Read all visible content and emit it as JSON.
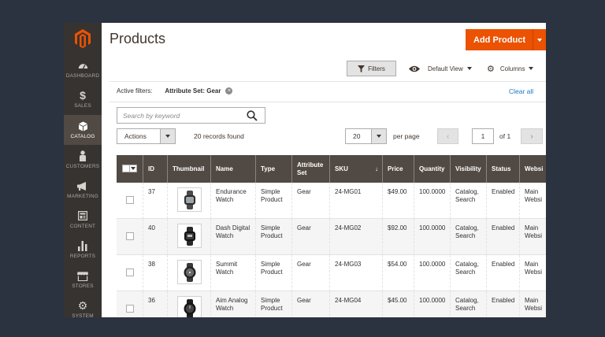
{
  "page": {
    "title": "Products"
  },
  "header": {
    "add_button": "Add Product"
  },
  "colors": {
    "accent": "#eb5202",
    "sidebar": "#373330",
    "table_header": "#514943",
    "link": "#1979c3"
  },
  "sidebar": {
    "items": [
      {
        "label": "DASHBOARD",
        "icon": "dashboard-icon"
      },
      {
        "label": "SALES",
        "icon": "dollar-icon"
      },
      {
        "label": "CATALOG",
        "icon": "cube-icon",
        "active": true
      },
      {
        "label": "CUSTOMERS",
        "icon": "person-icon"
      },
      {
        "label": "MARKETING",
        "icon": "megaphone-icon"
      },
      {
        "label": "CONTENT",
        "icon": "content-icon"
      },
      {
        "label": "REPORTS",
        "icon": "bar-chart-icon"
      },
      {
        "label": "STORES",
        "icon": "store-icon"
      },
      {
        "label": "SYSTEM",
        "icon": "gear-icon"
      }
    ]
  },
  "toolbar": {
    "filters": "Filters",
    "view": "Default View",
    "columns": "Columns"
  },
  "active_filters": {
    "label": "Active filters:",
    "tag": "Attribute Set: Gear",
    "clear": "Clear all"
  },
  "search": {
    "placeholder": "Search by keyword"
  },
  "actions": {
    "label": "Actions",
    "records": "20 records found"
  },
  "pagination": {
    "per_page_value": "20",
    "per_page_label": "per page",
    "current": "1",
    "of": "of 1"
  },
  "table": {
    "columns": [
      "ID",
      "Thumbnail",
      "Name",
      "Type",
      "Attribute Set",
      "SKU",
      "Price",
      "Quantity",
      "Visibility",
      "Status",
      "Websi"
    ],
    "rows": [
      {
        "id": "37",
        "name": "Endurance Watch",
        "type": "Simple Product",
        "attr": "Gear",
        "sku": "24-MG01",
        "price": "$49.00",
        "qty": "100.0000",
        "visibility": "Catalog, Search",
        "status": "Enabled",
        "website": "Main Websi"
      },
      {
        "id": "40",
        "name": "Dash Digital Watch",
        "type": "Simple Product",
        "attr": "Gear",
        "sku": "24-MG02",
        "price": "$92.00",
        "qty": "100.0000",
        "visibility": "Catalog, Search",
        "status": "Enabled",
        "website": "Main Websi"
      },
      {
        "id": "38",
        "name": "Summit Watch",
        "type": "Simple Product",
        "attr": "Gear",
        "sku": "24-MG03",
        "price": "$54.00",
        "qty": "100.0000",
        "visibility": "Catalog, Search",
        "status": "Enabled",
        "website": "Main Websi"
      },
      {
        "id": "36",
        "name": "Aim Analog Watch",
        "type": "Simple Product",
        "attr": "Gear",
        "sku": "24-MG04",
        "price": "$45.00",
        "qty": "100.0000",
        "visibility": "Catalog, Search",
        "status": "Enabled",
        "website": "Main Websi"
      }
    ]
  }
}
